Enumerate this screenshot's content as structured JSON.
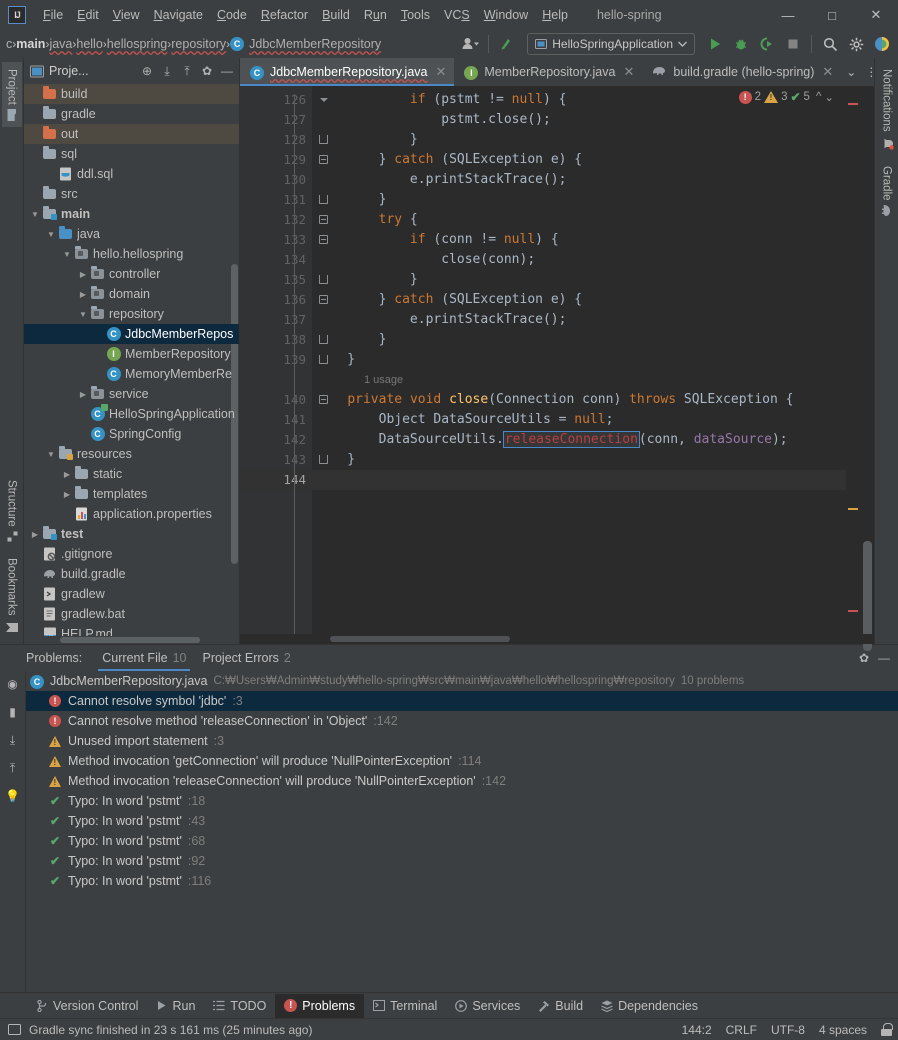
{
  "window": {
    "project_name": "hello-spring",
    "logo": "IJ",
    "minimize": "—",
    "maximize": "□",
    "close": "✕"
  },
  "menu": [
    {
      "label": "File",
      "accel": "F"
    },
    {
      "label": "Edit",
      "accel": "E"
    },
    {
      "label": "View",
      "accel": "V"
    },
    {
      "label": "Navigate",
      "accel": "N"
    },
    {
      "label": "Code",
      "accel": "C"
    },
    {
      "label": "Refactor",
      "accel": "R"
    },
    {
      "label": "Build",
      "accel": "B"
    },
    {
      "label": "Run",
      "accel": "u"
    },
    {
      "label": "Tools",
      "accel": "T"
    },
    {
      "label": "VCS",
      "accel": "S"
    },
    {
      "label": "Window",
      "accel": "W"
    },
    {
      "label": "Help",
      "accel": "H"
    }
  ],
  "navbar": {
    "crumbs": [
      "c",
      "main",
      "java",
      "hello",
      "hellospring",
      "repository",
      "JdbcMemberRepository"
    ],
    "separator": "›",
    "class_icon": "C",
    "run_config": "HelloSpringApplication",
    "icons": {
      "account": "account-icon",
      "updates": "update-project-icon",
      "run": "run-icon",
      "debug": "debug-icon",
      "run_coverage": "run-with-coverage-icon",
      "stop": "stop-icon",
      "search": "search-everywhere-icon",
      "settings": "settings-icon",
      "ai": "ai-assistant-icon"
    }
  },
  "left_rail": {
    "top": [
      {
        "label": "Project",
        "icon": "folder-icon",
        "active": true
      }
    ],
    "bottom": [
      {
        "label": "Structure",
        "icon": "structure-icon"
      },
      {
        "label": "Bookmarks",
        "icon": "bookmark-icon"
      }
    ]
  },
  "right_rail": [
    {
      "label": "Notifications",
      "icon": "bell-icon",
      "has_badge": true
    },
    {
      "label": "Gradle",
      "icon": "gradle-elephant-icon"
    }
  ],
  "project_panel": {
    "title": "Proje...",
    "tools": [
      {
        "name": "select-opened-file-icon",
        "glyph": "⊕"
      },
      {
        "name": "expand-all-icon",
        "glyph": "⤓"
      },
      {
        "name": "collapse-all-icon",
        "glyph": "⤒"
      },
      {
        "name": "settings-icon",
        "glyph": "✿"
      },
      {
        "name": "hide-icon",
        "glyph": "—"
      }
    ],
    "tree": [
      {
        "label": "build",
        "indent": 0,
        "icon": "folder-orange",
        "arrow": "",
        "highlight": "modified"
      },
      {
        "label": "gradle",
        "indent": 0,
        "icon": "folder-gray",
        "arrow": ""
      },
      {
        "label": "out",
        "indent": 0,
        "icon": "folder-orange",
        "arrow": "",
        "highlight": "modified"
      },
      {
        "label": "sql",
        "indent": 0,
        "icon": "folder-gray",
        "arrow": ""
      },
      {
        "label": "ddl.sql",
        "indent": 1,
        "icon": "file-sql",
        "arrow": ""
      },
      {
        "label": "src",
        "indent": 0,
        "icon": "folder-gray",
        "arrow": "",
        "squiggle": true
      },
      {
        "label": "main",
        "indent": 0,
        "icon": "folder-src",
        "arrow": "v",
        "bold": true
      },
      {
        "label": "java",
        "indent": 1,
        "icon": "folder-blue",
        "arrow": "v"
      },
      {
        "label": "hello.hellospring",
        "indent": 2,
        "icon": "package",
        "arrow": "v",
        "squiggle": true
      },
      {
        "label": "controller",
        "indent": 3,
        "icon": "package",
        "arrow": ">"
      },
      {
        "label": "domain",
        "indent": 3,
        "icon": "package",
        "arrow": ">"
      },
      {
        "label": "repository",
        "indent": 3,
        "icon": "package",
        "arrow": "v",
        "squiggle": true
      },
      {
        "label": "JdbcMemberRepos",
        "indent": 4,
        "icon": "class",
        "arrow": "",
        "selected": true,
        "squiggle": true
      },
      {
        "label": "MemberRepository",
        "indent": 4,
        "icon": "interface",
        "arrow": ""
      },
      {
        "label": "MemoryMemberRe",
        "indent": 4,
        "icon": "class",
        "arrow": ""
      },
      {
        "label": "service",
        "indent": 3,
        "icon": "package",
        "arrow": ">"
      },
      {
        "label": "HelloSpringApplication",
        "indent": 3,
        "icon": "spring-class",
        "arrow": ""
      },
      {
        "label": "SpringConfig",
        "indent": 3,
        "icon": "class",
        "arrow": ""
      },
      {
        "label": "resources",
        "indent": 1,
        "icon": "folder-resources",
        "arrow": "v"
      },
      {
        "label": "static",
        "indent": 2,
        "icon": "folder-gray",
        "arrow": ">"
      },
      {
        "label": "templates",
        "indent": 2,
        "icon": "folder-gray",
        "arrow": ">"
      },
      {
        "label": "application.properties",
        "indent": 2,
        "icon": "file-properties",
        "arrow": ""
      },
      {
        "label": "test",
        "indent": 0,
        "icon": "folder-src",
        "arrow": ">",
        "bold": true
      },
      {
        "label": ".gitignore",
        "indent": 0,
        "icon": "file-gitignore",
        "arrow": ""
      },
      {
        "label": "build.gradle",
        "indent": 0,
        "icon": "file-gradle",
        "arrow": ""
      },
      {
        "label": "gradlew",
        "indent": 0,
        "icon": "file-script",
        "arrow": ""
      },
      {
        "label": "gradlew.bat",
        "indent": 0,
        "icon": "file-bat",
        "arrow": ""
      },
      {
        "label": "HELP.md",
        "indent": 0,
        "icon": "file-md",
        "arrow": ""
      }
    ]
  },
  "editor": {
    "tabs": [
      {
        "label": "JdbcMemberRepository.java",
        "icon": "class",
        "active": true,
        "squiggle": true
      },
      {
        "label": "MemberRepository.java",
        "icon": "interface",
        "active": false
      },
      {
        "label": "build.gradle (hello-spring)",
        "icon": "gradle",
        "active": false
      }
    ],
    "tab_actions": [
      {
        "name": "show-hidden-tabs-icon",
        "glyph": "⌄"
      },
      {
        "name": "tab-options-icon",
        "glyph": "⋮"
      }
    ],
    "inspection": {
      "errors": "2",
      "warnings": "3",
      "typos": "5",
      "prev": "^",
      "next": "⌄"
    },
    "usage_hint": "1 usage",
    "first_line": 126,
    "lines": [
      {
        "n": 126,
        "fold": "end-mid",
        "tokens": [
          {
            "t": "            ",
            "c": "ind"
          },
          {
            "t": "if",
            "c": "kw"
          },
          {
            "t": " (pstmt != ",
            "c": "plain"
          },
          {
            "t": "null",
            "c": "kw"
          },
          {
            "t": ") {",
            "c": "plain"
          }
        ]
      },
      {
        "n": 127,
        "fold": "",
        "tokens": [
          {
            "t": "                pstmt.close();",
            "c": "plain"
          }
        ]
      },
      {
        "n": 128,
        "fold": "end",
        "tokens": [
          {
            "t": "            }",
            "c": "plain"
          }
        ]
      },
      {
        "n": 129,
        "fold": "start",
        "tokens": [
          {
            "t": "        } ",
            "c": "plain"
          },
          {
            "t": "catch",
            "c": "kw"
          },
          {
            "t": " (SQLException e) {",
            "c": "plain"
          }
        ]
      },
      {
        "n": 130,
        "fold": "",
        "tokens": [
          {
            "t": "            e.printStackTrace();",
            "c": "plain"
          }
        ]
      },
      {
        "n": 131,
        "fold": "end",
        "tokens": [
          {
            "t": "        }",
            "c": "plain"
          }
        ]
      },
      {
        "n": 132,
        "fold": "start",
        "tokens": [
          {
            "t": "        ",
            "c": "plain"
          },
          {
            "t": "try",
            "c": "kw"
          },
          {
            "t": " {",
            "c": "plain"
          }
        ]
      },
      {
        "n": 133,
        "fold": "start",
        "tokens": [
          {
            "t": "            ",
            "c": "plain"
          },
          {
            "t": "if",
            "c": "kw"
          },
          {
            "t": " (conn != ",
            "c": "plain"
          },
          {
            "t": "null",
            "c": "kw"
          },
          {
            "t": ") {",
            "c": "plain"
          }
        ]
      },
      {
        "n": 134,
        "fold": "",
        "tokens": [
          {
            "t": "                close(conn);",
            "c": "plain"
          }
        ]
      },
      {
        "n": 135,
        "fold": "end",
        "tokens": [
          {
            "t": "            }",
            "c": "plain"
          }
        ]
      },
      {
        "n": 136,
        "fold": "start",
        "tokens": [
          {
            "t": "        } ",
            "c": "plain"
          },
          {
            "t": "catch",
            "c": "kw"
          },
          {
            "t": " (SQLException e) {",
            "c": "plain"
          }
        ]
      },
      {
        "n": 137,
        "fold": "",
        "tokens": [
          {
            "t": "            e.printStackTrace();",
            "c": "plain"
          }
        ]
      },
      {
        "n": 138,
        "fold": "end",
        "tokens": [
          {
            "t": "        }",
            "c": "plain"
          }
        ]
      },
      {
        "n": 139,
        "fold": "end",
        "tokens": [
          {
            "t": "    }",
            "c": "plain"
          }
        ]
      },
      {
        "n": null,
        "fold": "",
        "usage": true,
        "tokens": []
      },
      {
        "n": 140,
        "fold": "start",
        "tokens": [
          {
            "t": "    ",
            "c": "plain"
          },
          {
            "t": "private",
            "c": "kw"
          },
          {
            "t": " ",
            "c": "plain"
          },
          {
            "t": "void",
            "c": "kw"
          },
          {
            "t": " ",
            "c": "plain"
          },
          {
            "t": "close",
            "c": "fn"
          },
          {
            "t": "(Connection conn) ",
            "c": "plain"
          },
          {
            "t": "throws",
            "c": "kw"
          },
          {
            "t": " SQLException {",
            "c": "plain"
          }
        ]
      },
      {
        "n": 141,
        "fold": "",
        "tokens": [
          {
            "t": "        Object DataSourceUtils = ",
            "c": "plain"
          },
          {
            "t": "null",
            "c": "kw"
          },
          {
            "t": ";",
            "c": "plain"
          }
        ]
      },
      {
        "n": 142,
        "fold": "",
        "tokens": [
          {
            "t": "        DataSourceUtils.",
            "c": "plain"
          },
          {
            "t": "releaseConnection",
            "c": "errbox"
          },
          {
            "t": "(conn, ",
            "c": "plain"
          },
          {
            "t": "dataSource",
            "c": "fldref"
          },
          {
            "t": ");",
            "c": "plain"
          }
        ]
      },
      {
        "n": 143,
        "fold": "end",
        "tokens": [
          {
            "t": "    }",
            "c": "plain"
          }
        ]
      },
      {
        "n": 144,
        "fold": "",
        "current": true,
        "tokens": []
      }
    ]
  },
  "problems": {
    "label": "Problems:",
    "tabs": [
      {
        "label": "Current File",
        "count": "10",
        "active": true
      },
      {
        "label": "Project Errors",
        "count": "2",
        "active": false
      }
    ],
    "head_actions": [
      {
        "name": "settings-icon",
        "glyph": "✿"
      },
      {
        "name": "hide-icon",
        "glyph": "—"
      }
    ],
    "rail": [
      {
        "name": "preview-icon",
        "glyph": "◉"
      },
      {
        "name": "open-preview-panel-icon",
        "glyph": "▮"
      },
      {
        "name": "expand-all-icon",
        "glyph": "⤓"
      },
      {
        "name": "collapse-all-icon",
        "glyph": "⤒"
      },
      {
        "name": "inspection-lightbulb-icon",
        "glyph": "💡"
      }
    ],
    "file": {
      "name": "JdbcMemberRepository.java",
      "path": "C:₩Users₩Admin₩study₩hello-spring₩src₩main₩java₩hello₩hellospring₩repository",
      "count": "10 problems",
      "icon": "class"
    },
    "items": [
      {
        "severity": "error",
        "message": "Cannot resolve symbol 'jdbc'",
        "line": ":3",
        "selected": true
      },
      {
        "severity": "error",
        "message": "Cannot resolve method 'releaseConnection' in 'Object'",
        "line": ":142",
        "selected": false
      },
      {
        "severity": "warning",
        "message": "Unused import statement",
        "line": ":3",
        "selected": false
      },
      {
        "severity": "warning",
        "message": "Method invocation 'getConnection' will produce 'NullPointerException'",
        "line": ":114",
        "selected": false
      },
      {
        "severity": "warning",
        "message": "Method invocation 'releaseConnection' will produce 'NullPointerException'",
        "line": ":142",
        "selected": false
      },
      {
        "severity": "typo",
        "message": "Typo: In word 'pstmt'",
        "line": ":18",
        "selected": false
      },
      {
        "severity": "typo",
        "message": "Typo: In word 'pstmt'",
        "line": ":43",
        "selected": false
      },
      {
        "severity": "typo",
        "message": "Typo: In word 'pstmt'",
        "line": ":68",
        "selected": false
      },
      {
        "severity": "typo",
        "message": "Typo: In word 'pstmt'",
        "line": ":92",
        "selected": false
      },
      {
        "severity": "typo",
        "message": "Typo: In word 'pstmt'",
        "line": ":116",
        "selected": false
      }
    ]
  },
  "tool_window_bar": [
    {
      "label": "Version Control",
      "icon": "branch-icon",
      "active": false
    },
    {
      "label": "Run",
      "icon": "run-icon",
      "active": false
    },
    {
      "label": "TODO",
      "icon": "todo-icon",
      "active": false
    },
    {
      "label": "Problems",
      "icon": "problems-icon",
      "active": true
    },
    {
      "label": "Terminal",
      "icon": "terminal-icon",
      "active": false
    },
    {
      "label": "Services",
      "icon": "services-icon",
      "active": false
    },
    {
      "label": "Build",
      "icon": "build-hammer-icon",
      "active": false
    },
    {
      "label": "Dependencies",
      "icon": "dependencies-icon",
      "active": false
    }
  ],
  "status_bar": {
    "icon": "event-log-icon",
    "message": "Gradle sync finished in 23 s 161 ms (25 minutes ago)",
    "caret": "144:2",
    "line_separator": "CRLF",
    "encoding": "UTF-8",
    "indent": "4 spaces",
    "lock": "read-only-toggle-icon"
  },
  "colors": {
    "accent": "#4a88c7",
    "error": "#c75450",
    "warning": "#d9a343",
    "typo": "#59a869",
    "selection": "#0d293e",
    "panel_bg": "#3c3f41",
    "editor_bg": "#2b2b2b"
  }
}
